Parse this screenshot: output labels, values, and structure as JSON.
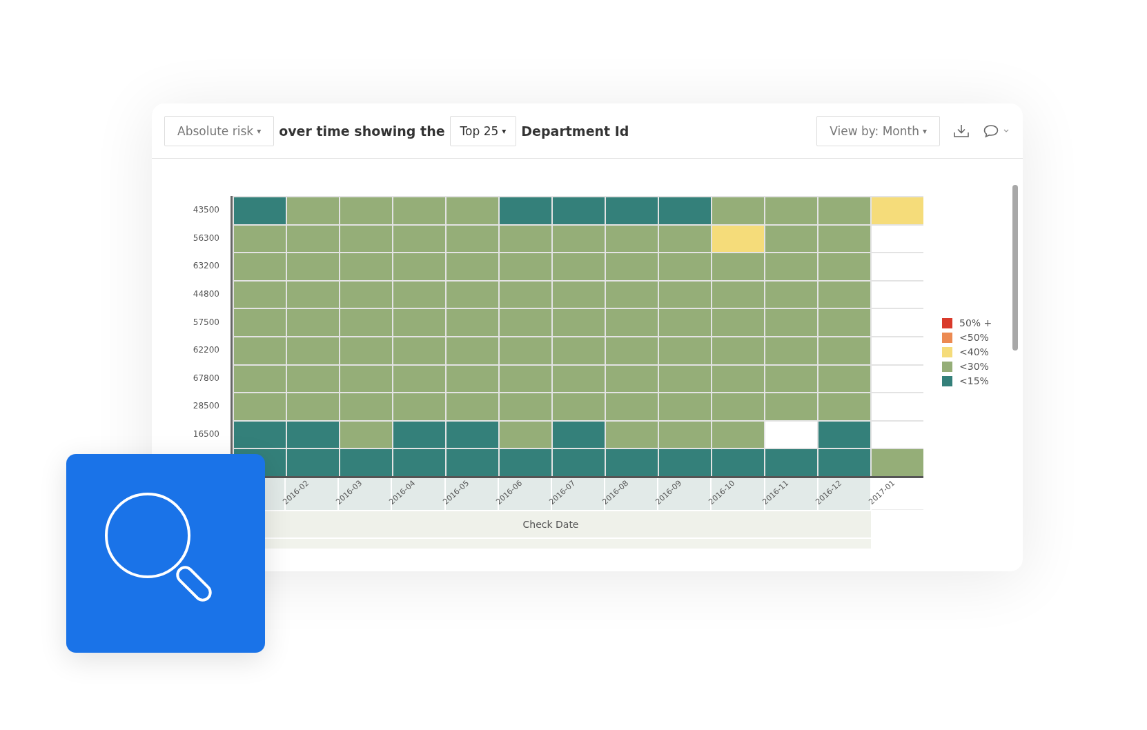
{
  "toolbar": {
    "measure": {
      "label": "Absolute risk",
      "caret": "▾"
    },
    "text_before": "over time showing the",
    "top": {
      "label": "Top 25",
      "caret": "▾"
    },
    "text_after": "Department Id",
    "view_by": {
      "label": "View by: Month",
      "caret": "▾"
    }
  },
  "heatmap": {
    "xlabel": "Check Date",
    "columns": [
      {},
      {
        "label": "2016-02"
      },
      {
        "label": "2016-03"
      },
      {
        "label": "2016-04"
      },
      {
        "label": "2016-05"
      },
      {
        "label": "2016-06"
      },
      {
        "label": "2016-07"
      },
      {
        "label": "2016-08"
      },
      {
        "label": "2016-09"
      },
      {
        "label": "2016-10"
      },
      {
        "label": "2016-11"
      },
      {
        "label": "2016-12"
      },
      {
        "label": "2017-01"
      }
    ],
    "rows": [
      {
        "label": "43500",
        "cells": [
          {
            "color": "#34807a"
          },
          {
            "color": "#95ae78"
          },
          {
            "color": "#95ae78"
          },
          {
            "color": "#95ae78"
          },
          {
            "color": "#95ae78"
          },
          {
            "color": "#34807a"
          },
          {
            "color": "#34807a"
          },
          {
            "color": "#34807a"
          },
          {
            "color": "#34807a"
          },
          {
            "color": "#95ae78"
          },
          {
            "color": "#95ae78"
          },
          {
            "color": "#95ae78"
          },
          {
            "color": "#f5dc7a"
          }
        ]
      },
      {
        "label": "56300",
        "cells": [
          {
            "color": "#95ae78"
          },
          {
            "color": "#95ae78"
          },
          {
            "color": "#95ae78"
          },
          {
            "color": "#95ae78"
          },
          {
            "color": "#95ae78"
          },
          {
            "color": "#95ae78"
          },
          {
            "color": "#95ae78"
          },
          {
            "color": "#95ae78"
          },
          {
            "color": "#95ae78"
          },
          {
            "color": "#f5dc7a"
          },
          {
            "color": "#95ae78"
          },
          {
            "color": "#95ae78"
          },
          null
        ]
      },
      {
        "label": "63200",
        "cells": [
          {
            "color": "#95ae78"
          },
          {
            "color": "#95ae78"
          },
          {
            "color": "#95ae78"
          },
          {
            "color": "#95ae78"
          },
          {
            "color": "#95ae78"
          },
          {
            "color": "#95ae78"
          },
          {
            "color": "#95ae78"
          },
          {
            "color": "#95ae78"
          },
          {
            "color": "#95ae78"
          },
          {
            "color": "#95ae78"
          },
          {
            "color": "#95ae78"
          },
          {
            "color": "#95ae78"
          },
          null
        ]
      },
      {
        "label": "44800",
        "cells": [
          {
            "color": "#95ae78"
          },
          {
            "color": "#95ae78"
          },
          {
            "color": "#95ae78"
          },
          {
            "color": "#95ae78"
          },
          {
            "color": "#95ae78"
          },
          {
            "color": "#95ae78"
          },
          {
            "color": "#95ae78"
          },
          {
            "color": "#95ae78"
          },
          {
            "color": "#95ae78"
          },
          {
            "color": "#95ae78"
          },
          {
            "color": "#95ae78"
          },
          {
            "color": "#95ae78"
          },
          null
        ]
      },
      {
        "label": "57500",
        "cells": [
          {
            "color": "#95ae78"
          },
          {
            "color": "#95ae78"
          },
          {
            "color": "#95ae78"
          },
          {
            "color": "#95ae78"
          },
          {
            "color": "#95ae78"
          },
          {
            "color": "#95ae78"
          },
          {
            "color": "#95ae78"
          },
          {
            "color": "#95ae78"
          },
          {
            "color": "#95ae78"
          },
          {
            "color": "#95ae78"
          },
          {
            "color": "#95ae78"
          },
          {
            "color": "#95ae78"
          },
          null
        ]
      },
      {
        "label": "62200",
        "cells": [
          {
            "color": "#95ae78"
          },
          {
            "color": "#95ae78"
          },
          {
            "color": "#95ae78"
          },
          {
            "color": "#95ae78"
          },
          {
            "color": "#95ae78"
          },
          {
            "color": "#95ae78"
          },
          {
            "color": "#95ae78"
          },
          {
            "color": "#95ae78"
          },
          {
            "color": "#95ae78"
          },
          {
            "color": "#95ae78"
          },
          {
            "color": "#95ae78"
          },
          {
            "color": "#95ae78"
          },
          null
        ]
      },
      {
        "label": "67800",
        "cells": [
          {
            "color": "#95ae78"
          },
          {
            "color": "#95ae78"
          },
          {
            "color": "#95ae78"
          },
          {
            "color": "#95ae78"
          },
          {
            "color": "#95ae78"
          },
          {
            "color": "#95ae78"
          },
          {
            "color": "#95ae78"
          },
          {
            "color": "#95ae78"
          },
          {
            "color": "#95ae78"
          },
          {
            "color": "#95ae78"
          },
          {
            "color": "#95ae78"
          },
          {
            "color": "#95ae78"
          },
          null
        ]
      },
      {
        "label": "28500",
        "cells": [
          {
            "color": "#95ae78"
          },
          {
            "color": "#95ae78"
          },
          {
            "color": "#95ae78"
          },
          {
            "color": "#95ae78"
          },
          {
            "color": "#95ae78"
          },
          {
            "color": "#95ae78"
          },
          {
            "color": "#95ae78"
          },
          {
            "color": "#95ae78"
          },
          {
            "color": "#95ae78"
          },
          {
            "color": "#95ae78"
          },
          {
            "color": "#95ae78"
          },
          {
            "color": "#95ae78"
          },
          null
        ]
      },
      {
        "label": "16500",
        "cells": [
          {
            "color": "#34807a"
          },
          {
            "color": "#34807a"
          },
          {
            "color": "#95ae78"
          },
          {
            "color": "#34807a"
          },
          {
            "color": "#34807a"
          },
          {
            "color": "#95ae78"
          },
          {
            "color": "#34807a"
          },
          {
            "color": "#95ae78"
          },
          {
            "color": "#95ae78"
          },
          {
            "color": "#95ae78"
          },
          null,
          {
            "color": "#34807a"
          },
          null
        ]
      },
      {
        "cells": [
          {
            "color": "#34807a"
          },
          {
            "color": "#34807a"
          },
          {
            "color": "#34807a"
          },
          {
            "color": "#34807a"
          },
          {
            "color": "#34807a"
          },
          {
            "color": "#34807a"
          },
          {
            "color": "#34807a"
          },
          {
            "color": "#34807a"
          },
          {
            "color": "#34807a"
          },
          {
            "color": "#34807a"
          },
          {
            "color": "#34807a"
          },
          {
            "color": "#34807a"
          },
          {
            "color": "#95ae78"
          }
        ]
      }
    ]
  },
  "legend": [
    {
      "label": "50% +",
      "color": "#d93a2b"
    },
    {
      "label": "<50%",
      "color": "#ec8a52"
    },
    {
      "label": "<40%",
      "color": "#f5dc7a"
    },
    {
      "label": "<30%",
      "color": "#95ae78"
    },
    {
      "label": "<15%",
      "color": "#34807a"
    }
  ]
}
